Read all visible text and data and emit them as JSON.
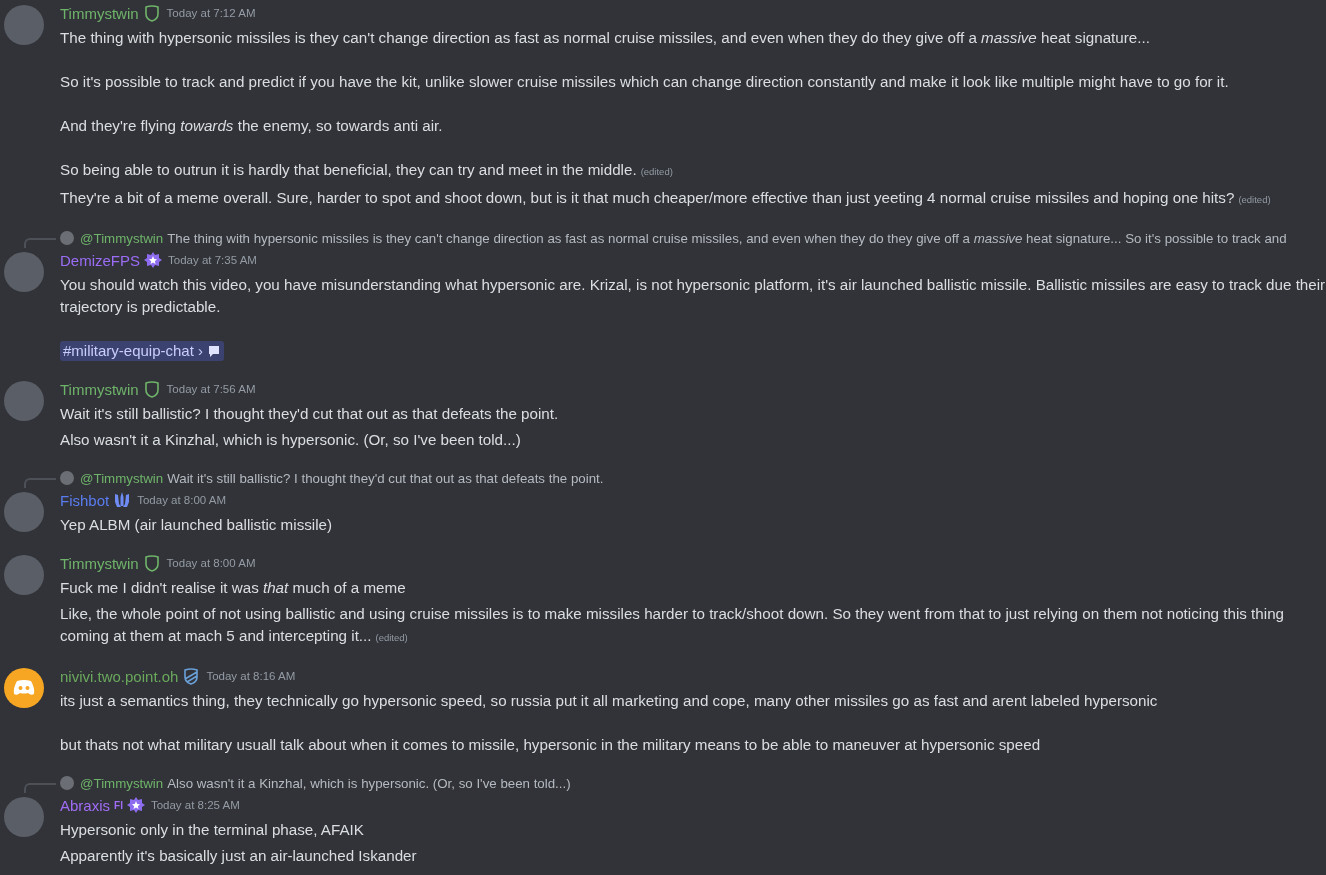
{
  "groups": [
    {
      "avatar": {
        "kind": "photo"
      },
      "author": "Timmystwin",
      "color": "#6fb36a",
      "badge": {
        "kind": "shield"
      },
      "time": "Today at 7:12 AM",
      "messages": [
        {
          "paragraphs": [
            {
              "kind": "text",
              "text": "The thing with hypersonic missiles is they can't change direction as fast as normal cruise missiles, and even when they do they give off a *massive* heat signature..."
            },
            {
              "kind": "text",
              "text": "So it's possible to track and predict if you have the kit, unlike slower cruise missiles which can change direction constantly and make it look like multiple might have to go for it."
            },
            {
              "kind": "text",
              "text": "And they're flying *towards* the enemy, so towards anti air."
            },
            {
              "kind": "text",
              "text": "So being able to outrun it is hardly that beneficial, they can try and meet in the middle."
            }
          ],
          "edited": "(edited)"
        },
        {
          "paragraphs": [
            {
              "kind": "text",
              "text": "They're a bit of a meme overall. Sure, harder to spot and shoot down, but is it that much cheaper/more effective than just yeeting 4 normal cruise missiles and hoping one hits?"
            }
          ],
          "edited": "(edited)"
        }
      ]
    },
    {
      "reply": {
        "author": "@Timmystwin",
        "color": "#6fb36a",
        "text": "The thing with hypersonic missiles is they can't change direction as fast as normal cruise missiles, and even when they do they give off a *massive* heat signature... So it's possible to track and"
      },
      "avatar": {
        "kind": "photo"
      },
      "author": "DemizeFPS",
      "color": "#9b6cf5",
      "badge": {
        "kind": "flower"
      },
      "time": "Today at 7:35 AM",
      "messages": [
        {
          "paragraphs": [
            {
              "kind": "text",
              "text": "You should watch this video, you have misunderstanding what hypersonic are. Krizal, is not hypersonic platform, it's air launched ballistic missile. Ballistic missiles are easy to track due their trajectory is predictable."
            },
            {
              "kind": "channel",
              "text": "#military-equip-chat",
              "chevron": "›"
            }
          ]
        }
      ]
    },
    {
      "avatar": {
        "kind": "photo"
      },
      "author": "Timmystwin",
      "color": "#6fb36a",
      "badge": {
        "kind": "shield"
      },
      "time": "Today at 7:56 AM",
      "messages": [
        {
          "paragraphs": [
            {
              "kind": "text",
              "text": "Wait it's still ballistic? I thought they'd cut that out as that defeats the point."
            }
          ]
        },
        {
          "paragraphs": [
            {
              "kind": "text",
              "text": "Also wasn't it a Kinzhal, which is hypersonic. (Or, so I've been told...)"
            }
          ]
        }
      ]
    },
    {
      "reply": {
        "author": "@Timmystwin",
        "color": "#6fb36a",
        "text": "Wait it's still ballistic? I thought they'd cut that out as that defeats the point."
      },
      "avatar": {
        "kind": "photo"
      },
      "author": "Fishbot",
      "color": "#5a7cf0",
      "badge": {
        "kind": "trident"
      },
      "time": "Today at 8:00 AM",
      "messages": [
        {
          "paragraphs": [
            {
              "kind": "text",
              "text": "Yep ALBM (air launched ballistic missile)"
            }
          ]
        }
      ]
    },
    {
      "avatar": {
        "kind": "photo"
      },
      "author": "Timmystwin",
      "color": "#6fb36a",
      "badge": {
        "kind": "shield"
      },
      "time": "Today at 8:00 AM",
      "messages": [
        {
          "paragraphs": [
            {
              "kind": "text",
              "text": "Fuck me I didn't realise it was *that* much of a meme"
            }
          ]
        },
        {
          "paragraphs": [
            {
              "kind": "text",
              "text": "Like, the whole point of not using ballistic and using cruise missiles is to make missiles harder to track/shoot down. So they went from that to just relying on them not noticing this thing coming at them at mach 5 and intercepting it..."
            }
          ],
          "edited": "(edited)"
        }
      ]
    },
    {
      "avatar": {
        "kind": "default"
      },
      "author": "nivivi.two.point.oh",
      "color": "#6aa85c",
      "badge": {
        "kind": "stripe-shield"
      },
      "time": "Today at 8:16 AM",
      "messages": [
        {
          "paragraphs": [
            {
              "kind": "text",
              "text": "its just a semantics thing, they technically go hypersonic speed, so russia put it all marketing and cope, many other missiles go as fast and arent labeled hypersonic"
            },
            {
              "kind": "text",
              "text": "but thats not what military usuall talk about when it comes to missile, hypersonic in the military means to be able to maneuver at hypersonic speed"
            }
          ]
        }
      ]
    },
    {
      "reply": {
        "author": "@Timmystwin",
        "color": "#6fb36a",
        "text": "Also wasn't it a Kinzhal, which is hypersonic. (Or, so I've been told...)"
      },
      "avatar": {
        "kind": "photo"
      },
      "author": "Abraxis",
      "color": "#a06cf5",
      "badge": {
        "kind": "flower"
      },
      "tag": "FI",
      "time": "Today at 8:25 AM",
      "messages": [
        {
          "paragraphs": [
            {
              "kind": "text",
              "text": "Hypersonic only in the terminal phase, AFAIK"
            }
          ]
        },
        {
          "paragraphs": [
            {
              "kind": "text",
              "text": "Apparently it's basically just an air-launched Iskander"
            }
          ]
        }
      ]
    }
  ]
}
